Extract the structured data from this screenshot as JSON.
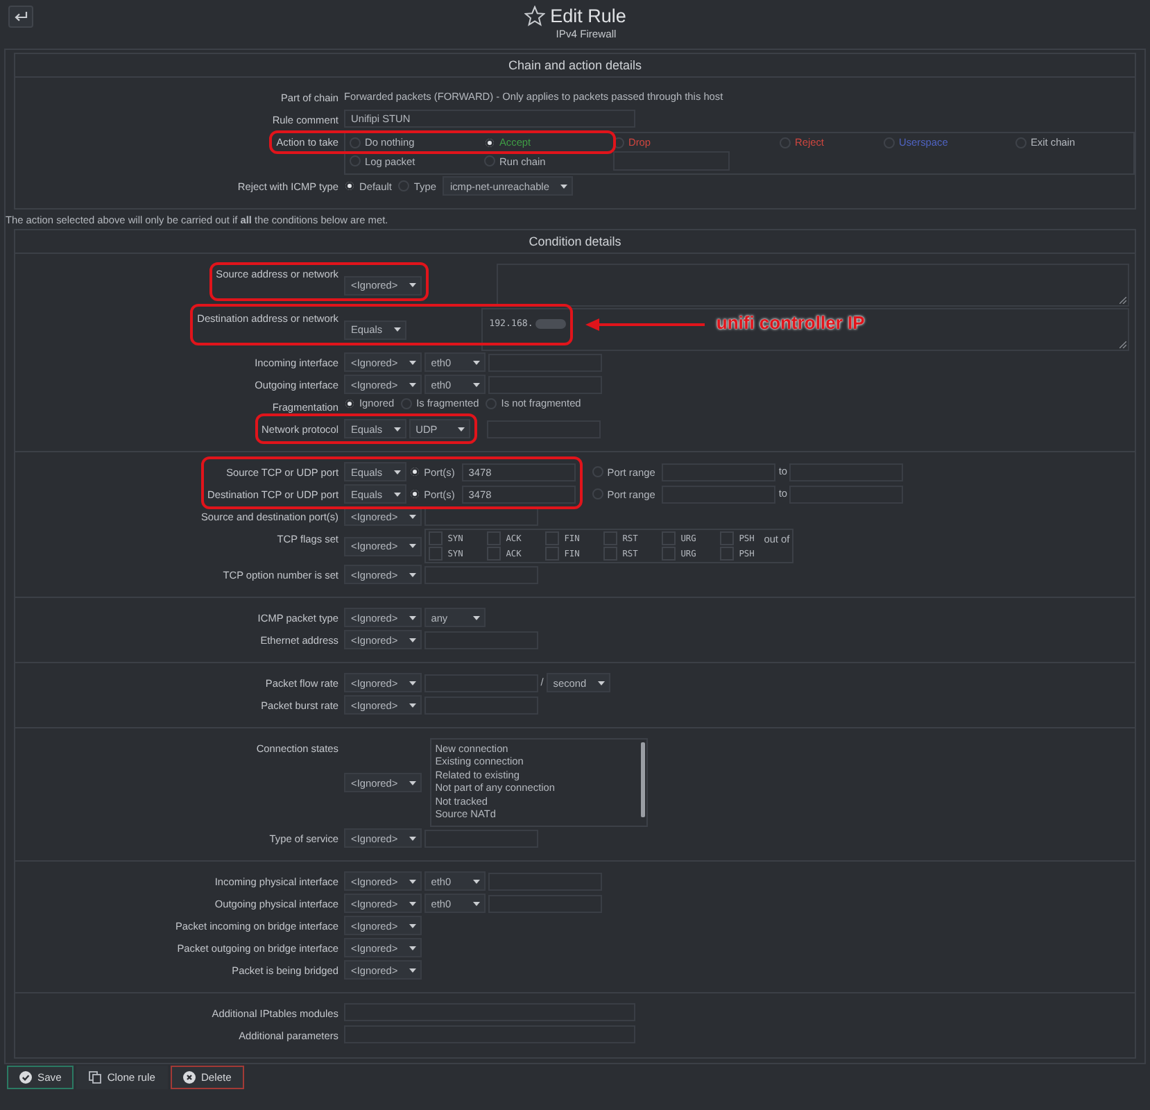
{
  "header": {
    "title": "Edit Rule",
    "subtitle": "IPv4 Firewall"
  },
  "blocks": [
    {
      "kind": "panel",
      "title": "Chain and action details",
      "groups": [
        {
          "rows": [
            {
              "label": "Part of chain",
              "fields": [
                {
                  "kind": "text",
                  "value": "Forwarded packets (FORWARD) - Only applies to packets passed through this host"
                }
              ]
            },
            {
              "label": "Rule comment",
              "fields": [
                {
                  "kind": "input",
                  "value": "Unifipi STUN"
                }
              ]
            },
            {
              "label": "Action to take",
              "kind": "grid",
              "outlined": true,
              "fields": [
                {
                  "kind": "radio",
                  "label": "Do nothing",
                  "selected": false
                },
                {
                  "kind": "radio",
                  "label": "Accept",
                  "selected": true,
                  "color": "#3f9e45"
                }
              ],
              "extras": [
                {
                  "kind": "radio",
                  "label": "Drop",
                  "selected": false,
                  "color": "#d0463f"
                },
                {
                  "kind": "radio",
                  "label": "Reject",
                  "selected": false,
                  "color": "#d0463f"
                },
                {
                  "kind": "radio",
                  "label": "Userspace",
                  "selected": false,
                  "color": "#4f63c2"
                },
                {
                  "kind": "radio",
                  "label": "Exit chain",
                  "selected": false
                },
                {
                  "kind": "radio",
                  "label": "Log packet",
                  "selected": false
                },
                {
                  "kind": "radio",
                  "label": "Run chain",
                  "selected": false
                },
                {
                  "kind": "input"
                }
              ]
            },
            {
              "label": "Reject with ICMP type",
              "fields": [
                {
                  "kind": "radio",
                  "label": "Default",
                  "selected": true
                },
                {
                  "kind": "radio",
                  "label": "Type",
                  "selected": false
                },
                {
                  "kind": "select",
                  "value": "icmp-net-unreachable"
                }
              ]
            }
          ]
        }
      ]
    },
    {
      "kind": "note",
      "text": "The action selected above will only be carried out if **all** the conditions below are met."
    },
    {
      "kind": "panel",
      "title": "Condition details",
      "groups": [
        {
          "rows": [
            {
              "label": "Source address or network",
              "outlined": true,
              "fields": [
                {
                  "kind": "select",
                  "value": "<Ignored>"
                }
              ],
              "extras": [
                {
                  "kind": "textarea"
                }
              ]
            },
            {
              "label": "Destination address or network",
              "outlined": true,
              "annotation": "unifi controller IP",
              "fields": [
                {
                  "kind": "select",
                  "value": "Equals"
                },
                {
                  "kind": "textarea",
                  "value": "192.168.",
                  "blurred": true
                }
              ]
            },
            {
              "label": "Incoming interface",
              "fields": [
                {
                  "kind": "select",
                  "value": "<Ignored>"
                },
                {
                  "kind": "select",
                  "value": "eth0"
                },
                {
                  "kind": "input"
                }
              ]
            },
            {
              "label": "Outgoing interface",
              "fields": [
                {
                  "kind": "select",
                  "value": "<Ignored>"
                },
                {
                  "kind": "select",
                  "value": "eth0"
                },
                {
                  "kind": "input"
                }
              ]
            },
            {
              "label": "Fragmentation",
              "fields": [
                {
                  "kind": "radio",
                  "label": "Ignored",
                  "selected": true
                },
                {
                  "kind": "radio",
                  "label": "Is fragmented",
                  "selected": false
                },
                {
                  "kind": "radio",
                  "label": "Is not fragmented",
                  "selected": false
                }
              ]
            },
            {
              "label": "Network protocol",
              "outlined": true,
              "fields": [
                {
                  "kind": "select",
                  "value": "Equals"
                },
                {
                  "kind": "select",
                  "value": "UDP"
                }
              ],
              "extras": [
                {
                  "kind": "input"
                }
              ]
            }
          ]
        },
        {
          "rows": [
            {
              "label": "Source TCP or UDP port",
              "outlined": true,
              "fields": [
                {
                  "kind": "select",
                  "value": "Equals"
                },
                {
                  "kind": "radio",
                  "label": "Port(s)",
                  "selected": true
                },
                {
                  "kind": "input",
                  "value": "3478"
                }
              ],
              "extras": [
                {
                  "kind": "radio",
                  "label": "Port range",
                  "selected": false
                },
                {
                  "kind": "input"
                },
                {
                  "kind": "text",
                  "value": "to"
                },
                {
                  "kind": "input"
                }
              ]
            },
            {
              "label": "Destination TCP or UDP port",
              "outlined": true,
              "joins_previous_outline": true,
              "fields": [
                {
                  "kind": "select",
                  "value": "Equals"
                },
                {
                  "kind": "radio",
                  "label": "Port(s)",
                  "selected": true
                },
                {
                  "kind": "input",
                  "value": "3478"
                }
              ],
              "extras": [
                {
                  "kind": "radio",
                  "label": "Port range",
                  "selected": false
                },
                {
                  "kind": "input"
                },
                {
                  "kind": "text",
                  "value": "to"
                },
                {
                  "kind": "input"
                }
              ]
            },
            {
              "label": "Source and destination port(s)",
              "fields": [
                {
                  "kind": "select",
                  "value": "<Ignored>"
                },
                {
                  "kind": "input"
                }
              ]
            },
            {
              "label": "TCP flags set",
              "fields": [
                {
                  "kind": "select",
                  "value": "<Ignored>"
                },
                {
                  "kind": "flaggrid",
                  "lines": [
                    {
                      "flags": [
                        {
                          "label": "SYN",
                          "checked": false
                        },
                        {
                          "label": "ACK",
                          "checked": false
                        },
                        {
                          "label": "FIN",
                          "checked": false
                        },
                        {
                          "label": "RST",
                          "checked": false
                        },
                        {
                          "label": "URG",
                          "checked": false
                        },
                        {
                          "label": "PSH",
                          "checked": false
                        }
                      ],
                      "suffix": "out of"
                    },
                    {
                      "flags": [
                        {
                          "label": "SYN",
                          "checked": false
                        },
                        {
                          "label": "ACK",
                          "checked": false
                        },
                        {
                          "label": "FIN",
                          "checked": false
                        },
                        {
                          "label": "RST",
                          "checked": false
                        },
                        {
                          "label": "URG",
                          "checked": false
                        },
                        {
                          "label": "PSH",
                          "checked": false
                        }
                      ]
                    }
                  ]
                }
              ]
            },
            {
              "label": "TCP option number is set",
              "fields": [
                {
                  "kind": "select",
                  "value": "<Ignored>"
                },
                {
                  "kind": "input"
                }
              ]
            }
          ]
        },
        {
          "rows": [
            {
              "label": "ICMP packet type",
              "fields": [
                {
                  "kind": "select",
                  "value": "<Ignored>"
                },
                {
                  "kind": "select",
                  "value": "any"
                }
              ]
            },
            {
              "label": "Ethernet address",
              "fields": [
                {
                  "kind": "select",
                  "value": "<Ignored>"
                },
                {
                  "kind": "input"
                }
              ]
            }
          ]
        },
        {
          "rows": [
            {
              "label": "Packet flow rate",
              "fields": [
                {
                  "kind": "select",
                  "value": "<Ignored>"
                },
                {
                  "kind": "input"
                },
                {
                  "kind": "text",
                  "value": "/"
                },
                {
                  "kind": "select",
                  "value": "second"
                }
              ]
            },
            {
              "label": "Packet burst rate",
              "fields": [
                {
                  "kind": "select",
                  "value": "<Ignored>"
                },
                {
                  "kind": "input"
                }
              ]
            }
          ]
        },
        {
          "rows": [
            {
              "label": "Connection states",
              "fields": [
                {
                  "kind": "select",
                  "value": "<Ignored>"
                },
                {
                  "kind": "listbox",
                  "options": [
                    {
                      "label": "New connection",
                      "selected": false
                    },
                    {
                      "label": "Existing connection",
                      "selected": false
                    },
                    {
                      "label": "Related to existing",
                      "selected": false
                    },
                    {
                      "label": "Not part of any connection",
                      "selected": false
                    },
                    {
                      "label": "Not tracked",
                      "selected": false
                    },
                    {
                      "label": "Source NATd",
                      "selected": false
                    }
                  ]
                }
              ]
            },
            {
              "label": "Type of service",
              "fields": [
                {
                  "kind": "select",
                  "value": "<Ignored>"
                },
                {
                  "kind": "input"
                }
              ]
            }
          ]
        },
        {
          "rows": [
            {
              "label": "Incoming physical interface",
              "fields": [
                {
                  "kind": "select",
                  "value": "<Ignored>"
                },
                {
                  "kind": "select",
                  "value": "eth0"
                },
                {
                  "kind": "input"
                }
              ]
            },
            {
              "label": "Outgoing physical interface",
              "fields": [
                {
                  "kind": "select",
                  "value": "<Ignored>"
                },
                {
                  "kind": "select",
                  "value": "eth0"
                },
                {
                  "kind": "input"
                }
              ]
            },
            {
              "label": "Packet incoming on bridge interface",
              "fields": [
                {
                  "kind": "select",
                  "value": "<Ignored>"
                }
              ]
            },
            {
              "label": "Packet outgoing on bridge interface",
              "fields": [
                {
                  "kind": "select",
                  "value": "<Ignored>"
                }
              ]
            },
            {
              "label": "Packet is being bridged",
              "fields": [
                {
                  "kind": "select",
                  "value": "<Ignored>"
                }
              ]
            }
          ]
        },
        {
          "rows": [
            {
              "label": "Additional IPtables modules",
              "fields": [
                {
                  "kind": "input"
                }
              ]
            },
            {
              "label": "Additional parameters",
              "fields": [
                {
                  "kind": "input"
                }
              ]
            }
          ]
        }
      ]
    }
  ],
  "buttons": [
    {
      "kind": "save",
      "label": "Save"
    },
    {
      "kind": "clone",
      "label": "Clone rule"
    },
    {
      "kind": "delete",
      "label": "Delete"
    }
  ]
}
